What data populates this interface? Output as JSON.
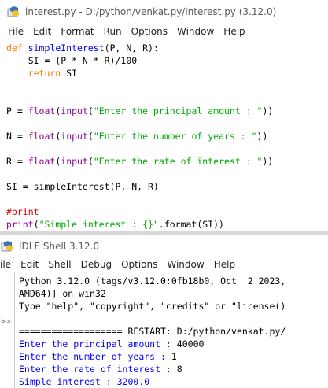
{
  "editor_window": {
    "title": "interest.py - D:/python/venkat.py/interest.py (3.12.0)",
    "menu": [
      "File",
      "Edit",
      "Format",
      "Run",
      "Options",
      "Window",
      "Help"
    ],
    "code": {
      "l1_kw": "def ",
      "l1_fn": "simpleInterest",
      "l1_rest": "(P, N, R):",
      "l2": "    SI = (P * N * R)/100",
      "l3_kw": "    return",
      "l3_rest": " SI",
      "l4_a": "P = ",
      "l4_float": "float",
      "l4_b": "(",
      "l4_input": "input",
      "l4_c": "(",
      "l4_str": "\"Enter the principal amount : \"",
      "l4_d": "))",
      "l5_a": "N = ",
      "l5_float": "float",
      "l5_b": "(",
      "l5_input": "input",
      "l5_c": "(",
      "l5_str": "\"Enter the number of years : \"",
      "l5_d": "))",
      "l6_a": "R = ",
      "l6_float": "float",
      "l6_b": "(",
      "l6_input": "input",
      "l6_c": "(",
      "l6_str": "\"Enter the rate of interest : \"",
      "l6_d": "))",
      "l7": "SI = simpleInterest(P, N, R)",
      "l8_comment": "#print",
      "l9_print": "print",
      "l9_a": "(",
      "l9_str": "\"Simple interest : {}\"",
      "l9_b": ".format(SI))"
    }
  },
  "shell_window": {
    "title": "IDLE Shell 3.12.0",
    "menu": [
      "ile",
      "Edit",
      "Shell",
      "Debug",
      "Options",
      "Window",
      "Help"
    ],
    "prompt": ">>",
    "lines": {
      "banner1": "Python 3.12.0 (tags/v3.12.0:0fb18b0, Oct  2 2023,",
      "banner2": "AMD64)] on win32",
      "banner3": "Type \"help\", \"copyright\", \"credits\" or \"license()",
      "restart": "=================== RESTART: D:/python/venkat.py/",
      "out1_label": "Enter the principal amount : ",
      "out1_value": "40000",
      "out2_label": "Enter the number of years : ",
      "out2_value": "1",
      "out3_label": "Enter the rate of interest : ",
      "out3_value": "8",
      "out4": "Simple interest : 3200.0"
    }
  },
  "colors": {
    "keyword": "#ff7700",
    "definition": "#0000ff",
    "builtin": "#900090",
    "string": "#00aa00",
    "comment": "#dd0000",
    "stdout": "#0000ff"
  },
  "icons": [
    "idle-app-icon"
  ]
}
